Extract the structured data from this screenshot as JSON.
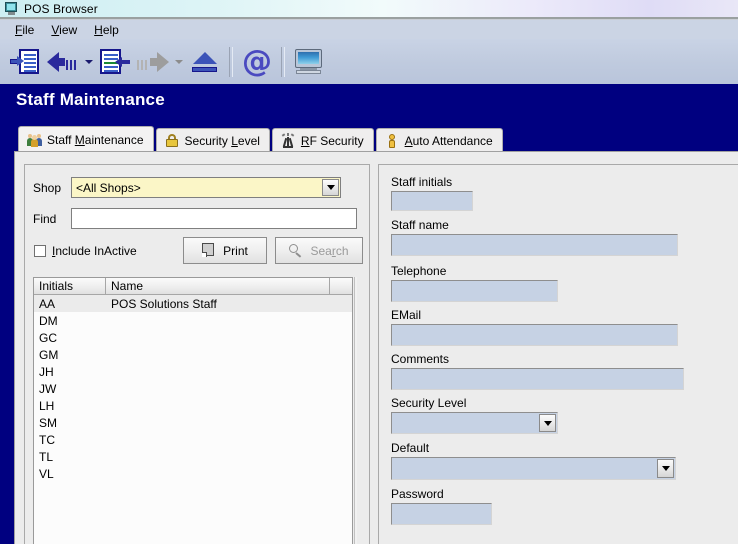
{
  "window": {
    "title": "POS Browser",
    "icon": "monitor-icon"
  },
  "menu": {
    "items": [
      {
        "label": "File",
        "accel": "F"
      },
      {
        "label": "View",
        "accel": "V"
      },
      {
        "label": "Help",
        "accel": "H"
      }
    ]
  },
  "toolbar": {
    "buttons": [
      {
        "name": "open-record-icon"
      },
      {
        "name": "back-arrow-icon"
      },
      {
        "name": "back-dropdown-caret-icon"
      },
      {
        "name": "document-in-icon"
      },
      {
        "name": "forward-arrow-icon"
      },
      {
        "name": "forward-dropdown-caret-icon"
      },
      {
        "name": "eject-icon"
      },
      {
        "name": "at-email-icon"
      },
      {
        "name": "monitor-icon"
      }
    ],
    "at_glyph": "@"
  },
  "header": {
    "page_title": "Staff Maintenance",
    "band_color": "#000080"
  },
  "tabs": [
    {
      "label_pre": "Staff ",
      "accel": "M",
      "label_post": "aintenance",
      "icon": "people-icon",
      "active": true
    },
    {
      "label_pre": "Security ",
      "accel": "L",
      "label_post": "evel",
      "icon": "padlock-icon",
      "active": false
    },
    {
      "label_pre": "",
      "accel": "R",
      "label_post": "F Security",
      "icon": "rf-antenna-icon",
      "active": false
    },
    {
      "label_pre": "",
      "accel": "A",
      "label_post": "uto Attendance",
      "icon": "person-icon",
      "active": false
    }
  ],
  "left_panel": {
    "shop": {
      "label": "Shop",
      "value": "<All Shops>",
      "options": [
        "<All Shops>"
      ],
      "field_color": "#fbf6c7"
    },
    "find": {
      "label": "Find",
      "value": "",
      "placeholder": ""
    },
    "include_inactive": {
      "label_pre": "",
      "accel": "I",
      "label_post": "nclude InActive",
      "checked": false
    },
    "print_button": {
      "label": "Print",
      "icon": "print-document-icon",
      "enabled": true
    },
    "search_button": {
      "label_pre": "Sea",
      "accel": "r",
      "label_post": "ch",
      "icon": "magnifier-icon",
      "enabled": false
    },
    "grid": {
      "columns": [
        "Initials",
        "Name",
        ""
      ],
      "rows": [
        {
          "initials": "AA",
          "name": "POS Solutions Staff",
          "selected": true
        },
        {
          "initials": "DM",
          "name": "",
          "selected": false
        },
        {
          "initials": "GC",
          "name": "",
          "selected": false
        },
        {
          "initials": "GM",
          "name": "",
          "selected": false
        },
        {
          "initials": "JH",
          "name": "",
          "selected": false
        },
        {
          "initials": "JW",
          "name": "",
          "selected": false
        },
        {
          "initials": "LH",
          "name": "",
          "selected": false
        },
        {
          "initials": "SM",
          "name": "",
          "selected": false
        },
        {
          "initials": "TC",
          "name": "",
          "selected": false
        },
        {
          "initials": "TL",
          "name": "",
          "selected": false
        },
        {
          "initials": "VL",
          "name": "",
          "selected": false
        }
      ]
    }
  },
  "right_panel": {
    "fields": [
      {
        "label": "Staff initials",
        "value": "",
        "type": "text"
      },
      {
        "label": "Staff name",
        "value": "",
        "type": "text"
      },
      {
        "label": "Telephone",
        "value": "",
        "type": "text"
      },
      {
        "label": "EMail",
        "value": "",
        "type": "text"
      },
      {
        "label": "Comments",
        "value": "",
        "type": "text"
      },
      {
        "label": "Security Level",
        "value": "",
        "type": "combo"
      },
      {
        "label": "Default",
        "value": "",
        "type": "combo"
      },
      {
        "label": "Password",
        "value": "",
        "type": "password"
      }
    ]
  },
  "colors": {
    "title_band": "#000080",
    "field_fill": "#c6d2e4",
    "shop_fill": "#fbf6c7",
    "panel_bg": "#ececec"
  }
}
